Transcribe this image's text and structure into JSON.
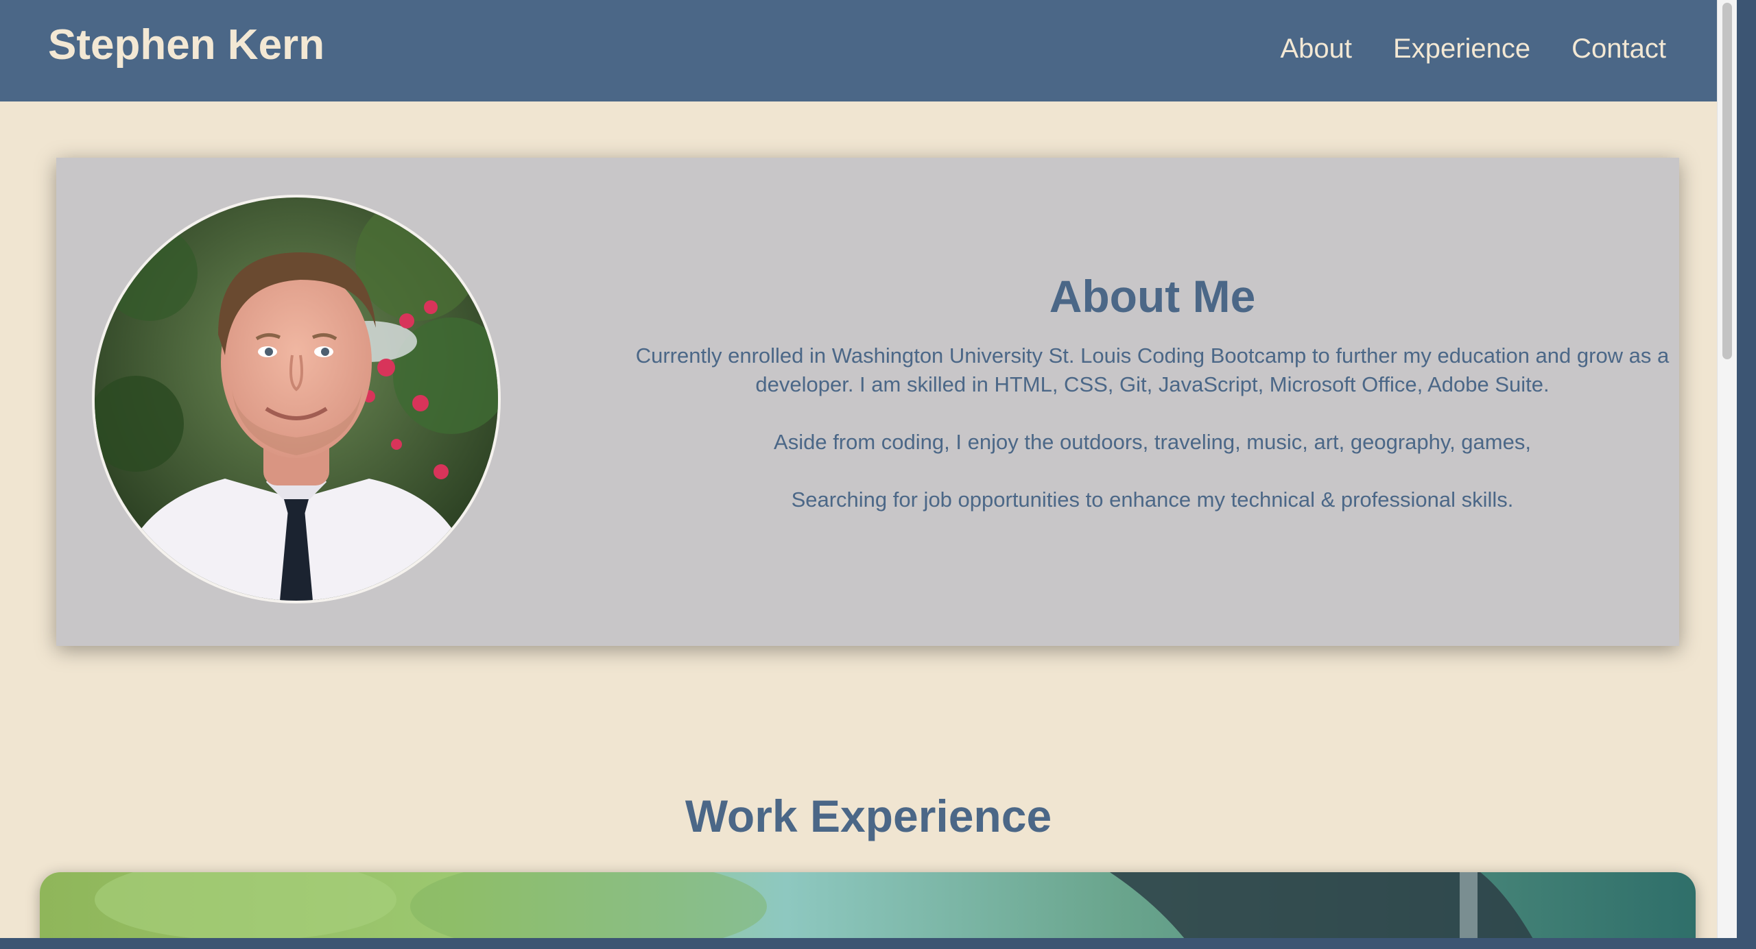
{
  "header": {
    "brand": "Stephen Kern",
    "nav": [
      {
        "label": "About"
      },
      {
        "label": "Experience"
      },
      {
        "label": "Contact"
      }
    ]
  },
  "about": {
    "title": "About Me",
    "paragraphs": [
      "Currently enrolled in Washington University St. Louis Coding Bootcamp to further my education and grow as a developer. I am skilled in HTML, CSS, Git, JavaScript, Microsoft Office, Adobe Suite.",
      "Aside from coding, I enjoy the outdoors, traveling, music, art, geography, games,",
      "Searching for job opportunities to enhance my technical & professional skills."
    ]
  },
  "experience": {
    "title": "Work Experience"
  },
  "colors": {
    "navbar": "#4b6787",
    "background": "#f0e5d1",
    "card": "#c8c6c8",
    "accent_text": "#4b6787",
    "nav_text": "#f3e8d4"
  }
}
